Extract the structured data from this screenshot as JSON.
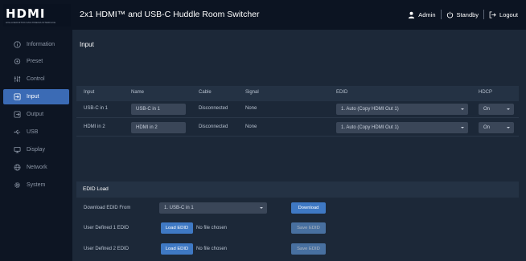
{
  "header": {
    "logo": "HDMI",
    "logo_tagline": "HIGH-DEFINITION MULTIMEDIA INTERFACE",
    "title": "2x1 HDMI™ and USB-C Huddle Room Switcher",
    "user": "Admin",
    "standby": "Standby",
    "logout": "Logout"
  },
  "sidebar": {
    "items": [
      {
        "label": "Information",
        "icon": "info-icon",
        "active": false
      },
      {
        "label": "Preset",
        "icon": "preset-icon",
        "active": false
      },
      {
        "label": "Control",
        "icon": "sliders-icon",
        "active": false
      },
      {
        "label": "Input",
        "icon": "input-icon",
        "active": true
      },
      {
        "label": "Output",
        "icon": "output-icon",
        "active": false
      },
      {
        "label": "USB",
        "icon": "usb-icon",
        "active": false
      },
      {
        "label": "Display",
        "icon": "monitor-icon",
        "active": false
      },
      {
        "label": "Network",
        "icon": "globe-icon",
        "active": false
      },
      {
        "label": "System",
        "icon": "gear-icon",
        "active": false
      }
    ]
  },
  "input": {
    "title": "Input",
    "columns": [
      "Input",
      "Name",
      "Cable",
      "Signal",
      "EDID",
      "HDCP"
    ],
    "rows": [
      {
        "input": "USB-C in 1",
        "name": "USB-C in 1",
        "cable": "Disconnected",
        "signal": "None",
        "edid": "1. Auto (Copy HDMI Out 1)",
        "hdcp": "On"
      },
      {
        "input": "HDMI in 2",
        "name": "HDMI in 2",
        "cable": "Disconnected",
        "signal": "None",
        "edid": "1. Auto (Copy HDMI Out 1)",
        "hdcp": "On"
      }
    ]
  },
  "edid_load": {
    "title": "EDID Load",
    "download_label": "Download EDID From",
    "download_select": "1. USB-C in 1",
    "download_button": "Download",
    "user1_label": "User Defined 1 EDID",
    "user2_label": "User Defined 2 EDID",
    "load_button": "Load EDID",
    "no_file": "No file chosen",
    "save_button": "Save EDID"
  },
  "colors": {
    "header_bg": "#0c1422",
    "sidebar_bg": "#0d1523",
    "content_bg": "#1c2838",
    "accent": "#3b6bb5",
    "button": "#3f79c4"
  }
}
